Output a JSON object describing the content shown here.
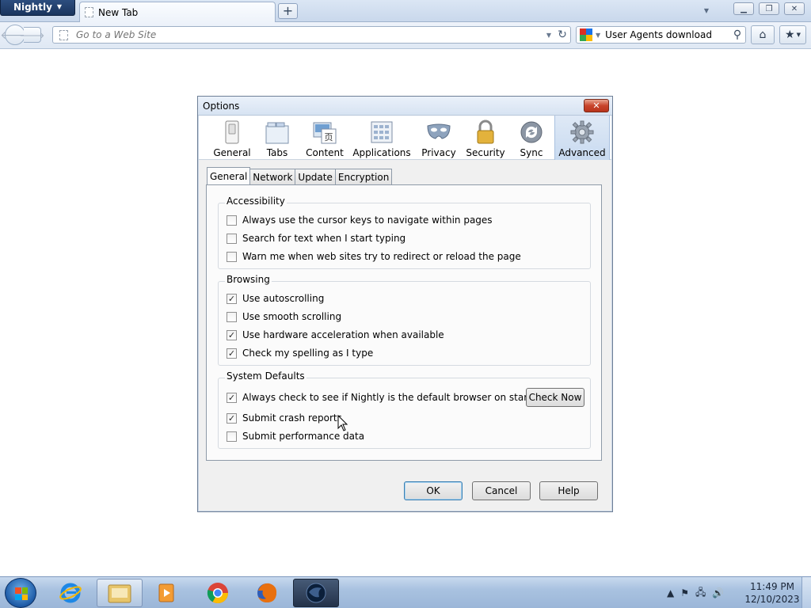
{
  "browser": {
    "app_menu_label": "Nightly",
    "tab_title": "New Tab",
    "url_placeholder": "Go to a Web Site",
    "search_value": "User Agents download"
  },
  "dialog": {
    "title": "Options",
    "panes": [
      {
        "label": "General",
        "icon": "light-switch-icon"
      },
      {
        "label": "Tabs",
        "icon": "tabs-icon"
      },
      {
        "label": "Content",
        "icon": "content-icon"
      },
      {
        "label": "Applications",
        "icon": "applications-icon"
      },
      {
        "label": "Privacy",
        "icon": "mask-icon"
      },
      {
        "label": "Security",
        "icon": "padlock-icon"
      },
      {
        "label": "Sync",
        "icon": "sync-icon"
      },
      {
        "label": "Advanced",
        "icon": "gear-icon"
      }
    ],
    "selected_pane": "Advanced",
    "subtabs": [
      "General",
      "Network",
      "Update",
      "Encryption"
    ],
    "active_subtab": "General",
    "accessibility": {
      "title": "Accessibility",
      "items": [
        {
          "label": "Always use the cursor keys to navigate within pages",
          "checked": false
        },
        {
          "label": "Search for text when I start typing",
          "checked": false
        },
        {
          "label": "Warn me when web sites try to redirect or reload the page",
          "checked": false
        }
      ]
    },
    "browsing": {
      "title": "Browsing",
      "items": [
        {
          "label": "Use autoscrolling",
          "checked": true
        },
        {
          "label": "Use smooth scrolling",
          "checked": false
        },
        {
          "label": "Use hardware acceleration when available",
          "checked": true
        },
        {
          "label": "Check my spelling as I type",
          "checked": true
        }
      ]
    },
    "system_defaults": {
      "title": "System Defaults",
      "items": [
        {
          "label": "Always check to see if Nightly is the default browser on startup",
          "checked": true
        },
        {
          "label": "Submit crash reports",
          "checked": true
        },
        {
          "label": "Submit performance data",
          "checked": false
        }
      ],
      "check_now_label": "Check Now"
    },
    "buttons": {
      "ok": "OK",
      "cancel": "Cancel",
      "help": "Help"
    }
  },
  "taskbar": {
    "time": "11:49 PM",
    "date": "12/10/2023"
  }
}
